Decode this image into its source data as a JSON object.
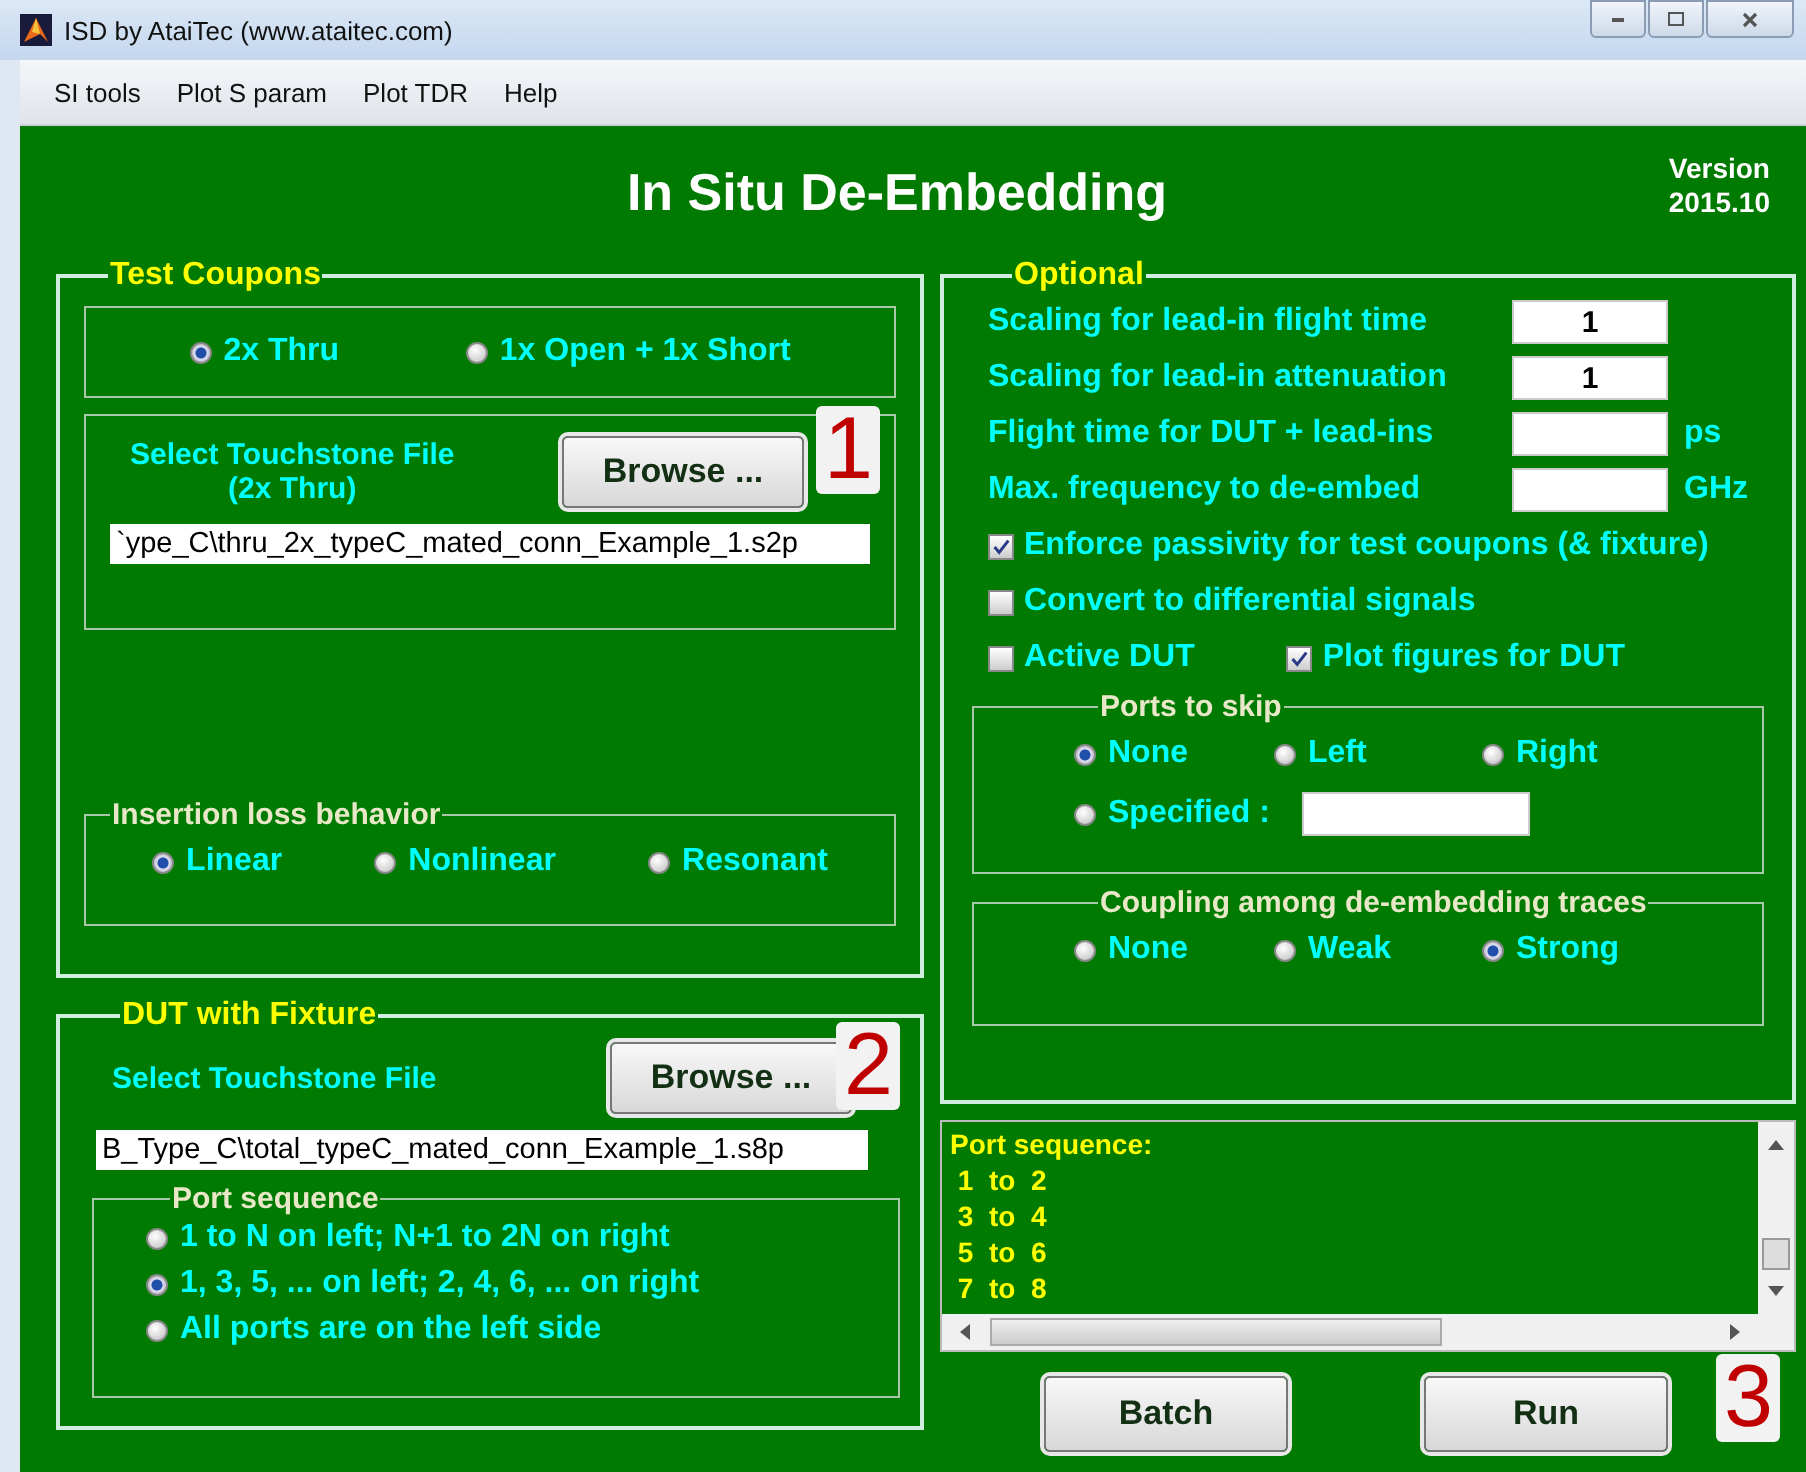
{
  "window": {
    "title": "ISD by AtaiTec (www.ataitec.com)"
  },
  "menu": [
    "SI tools",
    "Plot S param",
    "Plot TDR",
    "Help"
  ],
  "header": {
    "title": "In Situ De-Embedding",
    "version_label": "Version",
    "version": "2015.10"
  },
  "test_coupons": {
    "title": "Test Coupons",
    "coupon_type": [
      {
        "label": "2x Thru",
        "selected": true
      },
      {
        "label": "1x Open + 1x Short",
        "selected": false
      }
    ],
    "file_label": "Select Touchstone File",
    "file_sublabel": "(2x Thru)",
    "browse_button": "Browse ...",
    "file_path": "`ype_C\\thru_2x_typeC_mated_conn_Example_1.s2p",
    "insertion_loss": {
      "title": "Insertion loss behavior",
      "options": [
        {
          "label": "Linear",
          "selected": true
        },
        {
          "label": "Nonlinear",
          "selected": false
        },
        {
          "label": "Resonant",
          "selected": false
        }
      ]
    }
  },
  "dut": {
    "title": "DUT with Fixture",
    "file_label": "Select Touchstone File",
    "browse_button": "Browse ...",
    "file_path": "B_Type_C\\total_typeC_mated_conn_Example_1.s8p",
    "port_sequence": {
      "title": "Port sequence",
      "options": [
        {
          "label": "1 to N on left; N+1 to 2N on right",
          "selected": false
        },
        {
          "label": "1, 3, 5, ... on left; 2, 4, 6, ... on right",
          "selected": true
        },
        {
          "label": "All ports are on the left side",
          "selected": false
        }
      ]
    }
  },
  "optional": {
    "title": "Optional",
    "fields": [
      {
        "label": "Scaling for lead-in flight time",
        "value": "1"
      },
      {
        "label": "Scaling for lead-in attenuation",
        "value": "1"
      },
      {
        "label": "Flight time for DUT + lead-ins",
        "unit": "ps"
      },
      {
        "label": "Max. frequency to de-embed",
        "unit": "GHz"
      }
    ],
    "checkbox_rows": [
      [
        {
          "label": "Enforce passivity for test coupons (& fixture)",
          "checked": true
        }
      ],
      [
        {
          "label": "Convert to differential signals",
          "checked": false
        }
      ],
      [
        {
          "label": "Active DUT",
          "checked": false
        },
        {
          "label": "Plot figures for DUT",
          "checked": true
        }
      ]
    ],
    "ports_to_skip": {
      "title": "Ports to skip",
      "options": [
        {
          "label": "None",
          "selected": true,
          "kind": "plain"
        },
        {
          "label": "Left",
          "selected": false,
          "kind": "plain"
        },
        {
          "label": "Right",
          "selected": false,
          "kind": "plain"
        },
        {
          "label": "Specified :",
          "selected": false,
          "kind": "field"
        }
      ]
    },
    "coupling": {
      "title": "Coupling among de-embedding traces",
      "options": [
        {
          "label": "None",
          "selected": false
        },
        {
          "label": "Weak",
          "selected": false
        },
        {
          "label": "Strong",
          "selected": true
        }
      ]
    }
  },
  "log": {
    "lines": [
      "Port sequence:",
      " 1  to  2",
      " 3  to  4",
      " 5  to  6",
      " 7  to  8"
    ]
  },
  "buttons": [
    "Batch",
    "Run"
  ],
  "annotations": [
    "1",
    "2",
    "3"
  ]
}
